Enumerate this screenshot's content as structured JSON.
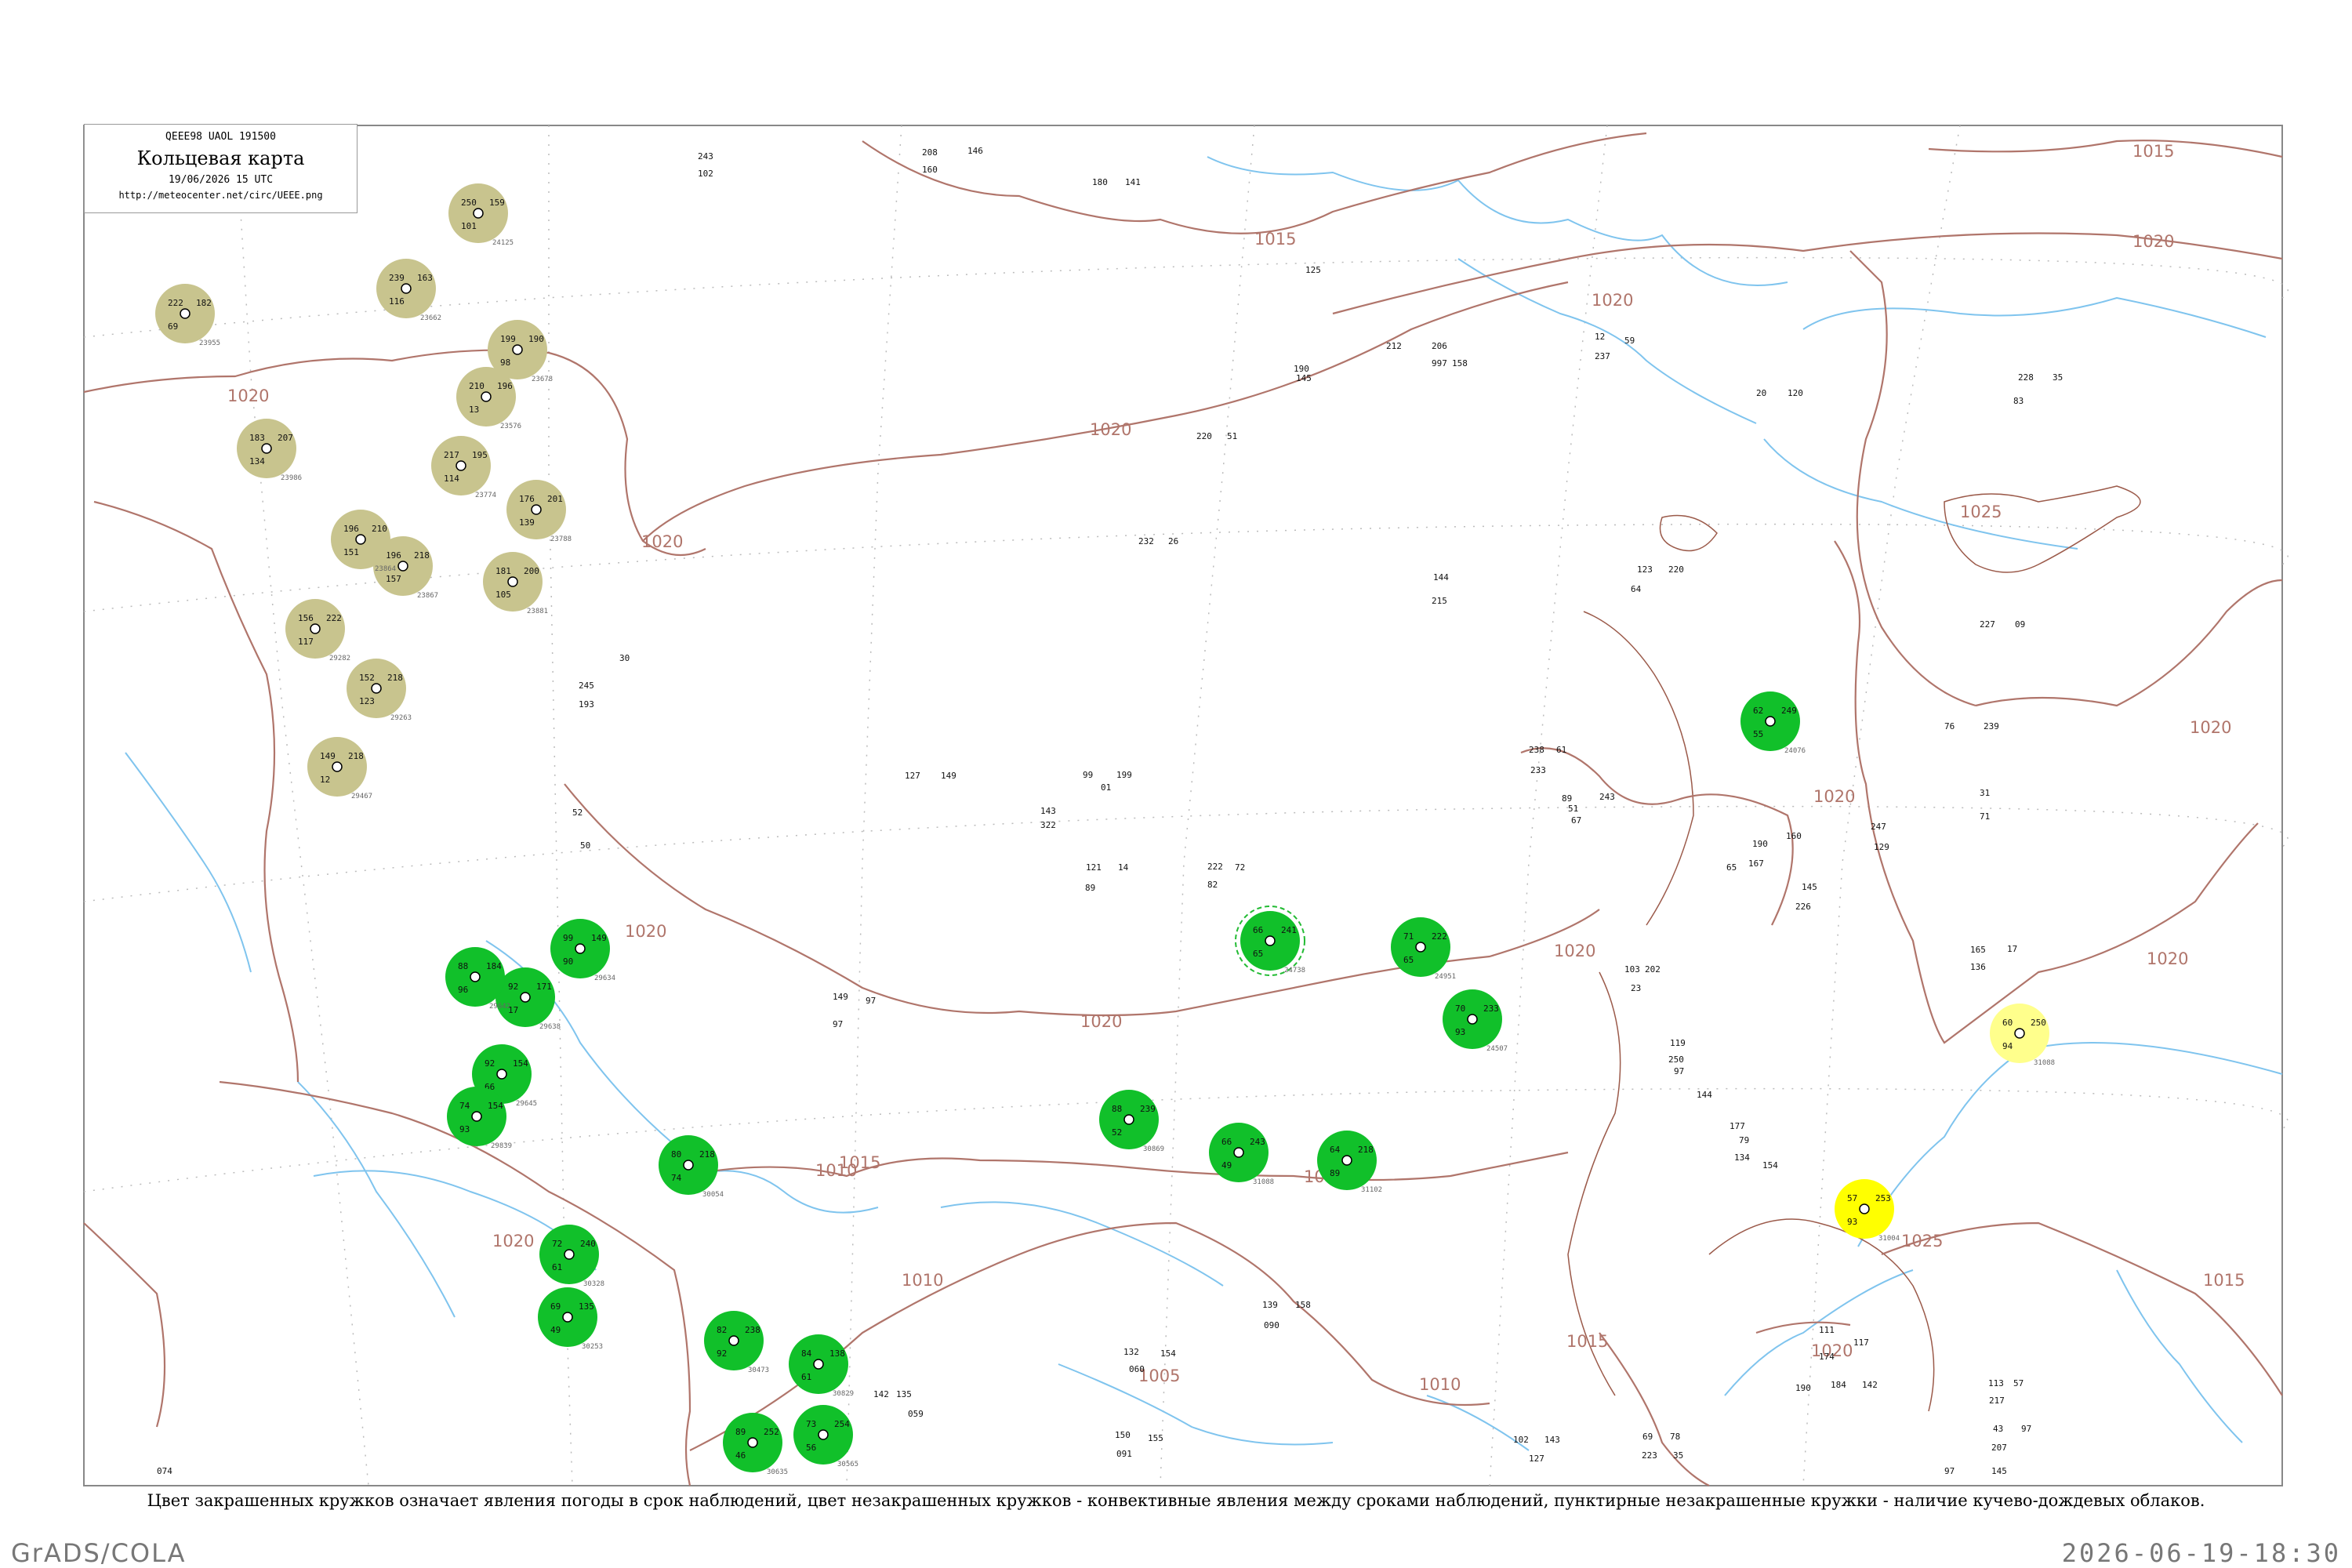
{
  "header": {
    "code": "QEEE98  UAOL  191500",
    "title": "Кольцевая карта",
    "datetime": "19/06/2026 15 UTC",
    "url": "http://meteocenter.net/circ/UEEE.png"
  },
  "caption": "Цвет закрашенных кружков означает явления погоды в срок наблюдений, цвет незакрашенных кружков - конвективные явления между сроками наблюдений, пунктирные незакрашенные кружки - наличие кучево-дождевых облаков.",
  "footer": {
    "left": "GrADS/COLA",
    "right": "2026-06-19-18:30"
  },
  "colors": {
    "isobar": "#b0756b",
    "river": "#7fc4ee",
    "rain": "#11c02a",
    "haze": "#c8c48e",
    "fog": "#ffff00",
    "light_yellow": "#ffff8c",
    "dashed_ring": "#22bb33",
    "frame": "#888888"
  },
  "isobar_labels": [
    "1015",
    "1015",
    "1020",
    "1020",
    "1020",
    "1020",
    "1020",
    "1020",
    "1020",
    "1020",
    "1020",
    "1020",
    "1020",
    "1025",
    "1025",
    "1015",
    "1015",
    "1020",
    "1010",
    "1010",
    "1005",
    "1010",
    "1015",
    "1020",
    "1015"
  ],
  "stations": [
    {
      "code": "24125",
      "mark": "haze",
      "ring": false,
      "values": [
        "250",
        "159",
        "101"
      ]
    },
    {
      "code": "23662",
      "mark": "haze",
      "ring": false,
      "values": [
        "239",
        "163",
        "116"
      ]
    },
    {
      "code": "23678",
      "mark": "haze",
      "ring": false,
      "values": [
        "199",
        "190",
        "98"
      ]
    },
    {
      "code": "23576",
      "mark": "haze",
      "ring": false,
      "values": [
        "210",
        "196",
        "13"
      ]
    },
    {
      "code": "23774",
      "mark": "haze",
      "ring": false,
      "values": [
        "217",
        "195",
        "114"
      ]
    },
    {
      "code": "23788",
      "mark": "haze",
      "ring": false,
      "values": [
        "176",
        "201",
        "139"
      ]
    },
    {
      "code": "23881",
      "mark": "haze",
      "ring": false,
      "values": [
        "181",
        "200",
        "105"
      ]
    },
    {
      "code": "23867",
      "mark": "haze",
      "ring": false,
      "values": [
        "196",
        "218",
        "157"
      ]
    },
    {
      "code": "23864",
      "mark": "haze",
      "ring": false,
      "values": [
        "196",
        "210",
        "151"
      ]
    },
    {
      "code": "29282",
      "mark": "haze",
      "ring": false,
      "values": [
        "156",
        "222",
        "117"
      ]
    },
    {
      "code": "29263",
      "mark": "haze",
      "ring": false,
      "values": [
        "152",
        "218",
        "123"
      ]
    },
    {
      "code": "29467",
      "mark": "haze",
      "ring": false,
      "values": [
        "149",
        "218",
        "12"
      ]
    },
    {
      "code": "23986",
      "mark": "haze",
      "ring": false,
      "values": [
        "183",
        "207",
        "134"
      ]
    },
    {
      "code": "23955",
      "mark": "haze",
      "ring": false,
      "values": [
        "222",
        "182",
        "69"
      ]
    },
    {
      "code": "24738",
      "mark": "rain",
      "ring": true,
      "values": [
        "66",
        "241",
        "65"
      ]
    },
    {
      "code": "24951",
      "mark": "rain",
      "ring": false,
      "values": [
        "71",
        "222",
        "65"
      ]
    },
    {
      "code": "30869",
      "mark": "rain",
      "ring": false,
      "values": [
        "88",
        "239",
        "52"
      ]
    },
    {
      "code": "31088",
      "mark": "rain",
      "ring": false,
      "values": [
        "66",
        "243",
        "49"
      ]
    },
    {
      "code": "29634",
      "mark": "rain",
      "ring": false,
      "values": [
        "99",
        "149",
        "90"
      ]
    },
    {
      "code": "29638",
      "mark": "rain",
      "ring": false,
      "values": [
        "92",
        "171",
        "17"
      ]
    },
    {
      "code": "29642",
      "mark": "rain",
      "ring": false,
      "values": [
        "88",
        "184",
        "96"
      ]
    },
    {
      "code": "29645",
      "mark": "rain",
      "ring": false,
      "values": [
        "92",
        "154",
        "66"
      ]
    },
    {
      "code": "29839",
      "mark": "rain",
      "ring": false,
      "values": [
        "74",
        "154",
        "93"
      ]
    },
    {
      "code": "30054",
      "mark": "rain",
      "ring": false,
      "values": [
        "80",
        "218",
        "74"
      ]
    },
    {
      "code": "30328",
      "mark": "rain",
      "ring": false,
      "values": [
        "72",
        "240",
        "61"
      ]
    },
    {
      "code": "30253",
      "mark": "rain",
      "ring": false,
      "values": [
        "69",
        "135",
        "49"
      ]
    },
    {
      "code": "30473",
      "mark": "rain",
      "ring": false,
      "values": [
        "82",
        "238",
        "92"
      ]
    },
    {
      "code": "30829",
      "mark": "rain",
      "ring": false,
      "values": [
        "84",
        "138",
        "61"
      ]
    },
    {
      "code": "30635",
      "mark": "rain",
      "ring": false,
      "values": [
        "89",
        "252",
        "46"
      ]
    },
    {
      "code": "30565",
      "mark": "rain",
      "ring": false,
      "values": [
        "73",
        "254",
        "56"
      ]
    },
    {
      "code": "31102",
      "mark": "rain",
      "ring": false,
      "values": [
        "64",
        "218",
        "89"
      ]
    },
    {
      "code": "24507",
      "mark": "rain",
      "ring": false,
      "values": [
        "70",
        "233",
        "93"
      ]
    },
    {
      "code": "24076",
      "mark": "rain",
      "ring": false,
      "values": [
        "62",
        "249",
        "55"
      ]
    },
    {
      "code": "31004",
      "mark": "fog",
      "ring": false,
      "values": [
        "57",
        "253",
        "93"
      ]
    },
    {
      "code": "31088",
      "mark": "light_yellow",
      "ring": false,
      "values": [
        "60",
        "250",
        "94"
      ]
    }
  ],
  "plain_numbers": [
    "243",
    "102",
    "208",
    "160",
    "146",
    "180",
    "141",
    "125",
    "190",
    "145",
    "212",
    "206",
    "997",
    "158",
    "12",
    "59",
    "237",
    "20",
    "120",
    "228",
    "35",
    "83",
    "220",
    "51",
    "232",
    "26",
    "144",
    "215",
    "123",
    "220",
    "64",
    "227",
    "09",
    "76",
    "239",
    "31",
    "71",
    "247",
    "129",
    "190",
    "160",
    "167",
    "65",
    "226",
    "145",
    "165",
    "136",
    "17",
    "149",
    "97",
    "97",
    "245",
    "30",
    "193",
    "52",
    "50",
    "143",
    "322",
    "127",
    "149",
    "99",
    "199",
    "01",
    "121",
    "14",
    "89",
    "222",
    "72",
    "82",
    "238",
    "61",
    "233",
    "51",
    "89",
    "243",
    "67",
    "103",
    "202",
    "23",
    "119",
    "250",
    "97",
    "144",
    "177",
    "79",
    "134",
    "154",
    "111",
    "117",
    "174",
    "184",
    "142",
    "190",
    "113",
    "57",
    "217",
    "43",
    "97",
    "207",
    "69",
    "78",
    "223",
    "35",
    "102",
    "143",
    "127",
    "139",
    "158",
    "090",
    "150",
    "155",
    "091",
    "142",
    "135",
    "059",
    "132",
    "154",
    "060",
    "97",
    "145",
    "074"
  ]
}
